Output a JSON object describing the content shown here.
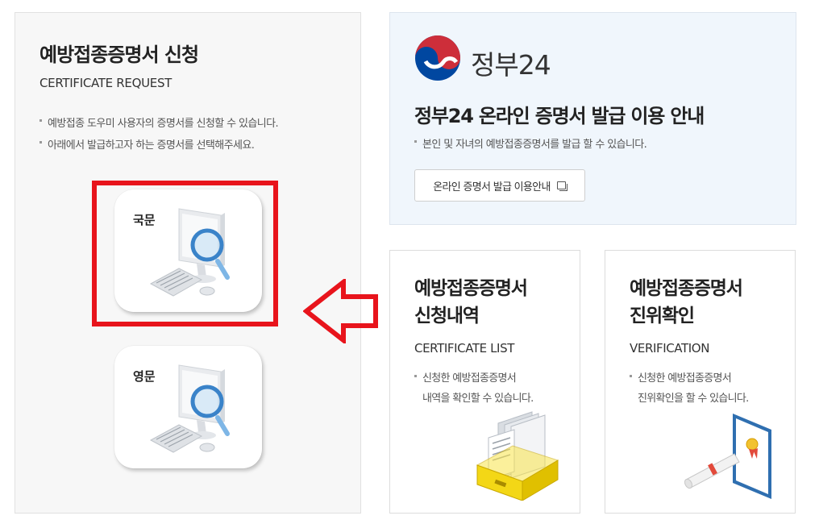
{
  "request": {
    "title": "예방접종증명서 신청",
    "subtitle": "CERTIFICATE REQUEST",
    "notes": [
      "예방접종 도우미 사용자의 증명서를 신청할 수 있습니다.",
      "아래에서 발급하고자 하는 증명서를 선택해주세요."
    ],
    "korean_label": "국문",
    "english_label": "영문"
  },
  "gov24": {
    "name": "정부24",
    "title": "정부24 온라인 증명서 발급 이용 안내",
    "note": "본인 및 자녀의 예방접종증명서를 발급 할 수 있습니다.",
    "button_label": "온라인 증명서 발급 이용안내"
  },
  "list_card": {
    "title_line1": "예방접종증명서",
    "title_line2": "신청내역",
    "subtitle": "CERTIFICATE LIST",
    "desc_line1": "신청한 예방접종증명서",
    "desc_line2": "내역을 확인할 수 있습니다."
  },
  "verify_card": {
    "title_line1": "예방접종증명서",
    "title_line2": "진위확인",
    "subtitle": "VERIFICATION",
    "desc_line1": "신청한 예방접종증명서",
    "desc_line2": "진위확인을 할 수 있습니다."
  },
  "colors": {
    "highlight": "#e8141c",
    "gov_red": "#cd2e3a",
    "gov_blue": "#0047a0",
    "gov_panel_bg": "#f0f6fc"
  },
  "icons": [
    "computer-search-icon",
    "new-window-icon",
    "arrow-left-icon",
    "file-box-icon",
    "certificate-icon"
  ]
}
